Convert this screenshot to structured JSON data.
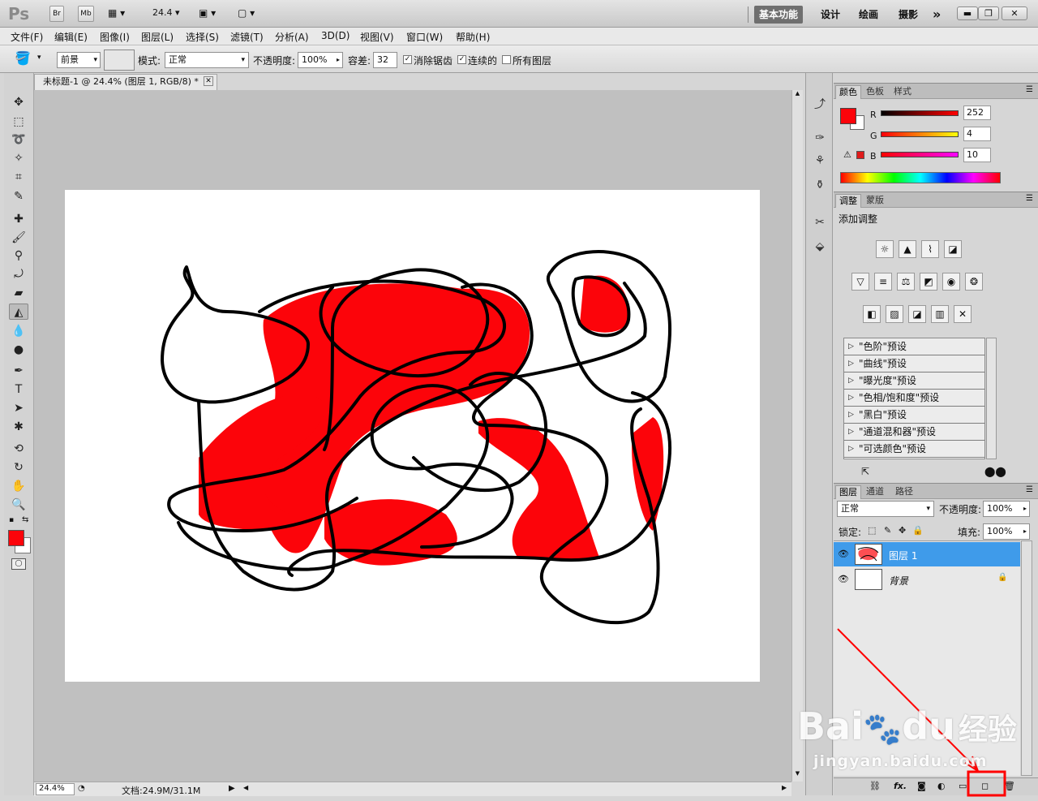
{
  "app": {
    "logo": "Ps",
    "bridge_label": "Br",
    "minibridge_label": "Mb",
    "zoom_value": "24.4",
    "workspaces": [
      "基本功能",
      "设计",
      "绘画",
      "摄影"
    ],
    "more_label": "»"
  },
  "menu": [
    "文件(F)",
    "编辑(E)",
    "图像(I)",
    "图层(L)",
    "选择(S)",
    "滤镜(T)",
    "分析(A)",
    "3D(D)",
    "视图(V)",
    "窗口(W)",
    "帮助(H)"
  ],
  "options": {
    "fill_source": "前景",
    "mode_label": "模式:",
    "mode_value": "正常",
    "opacity_label": "不透明度:",
    "opacity_value": "100%",
    "tolerance_label": "容差:",
    "tolerance_value": "32",
    "antialias_label": "消除锯齿",
    "contiguous_label": "连续的",
    "all_layers_label": "所有图层"
  },
  "document": {
    "tab_title": "未标题-1 @ 24.4% (图层 1, RGB/8) *",
    "zoom_status": "24.4%",
    "doc_status": "文档:24.9M/31.1M"
  },
  "color_panel": {
    "tabs": [
      "颜色",
      "色板",
      "样式"
    ],
    "channels": [
      {
        "label": "R",
        "value": "252"
      },
      {
        "label": "G",
        "value": "4"
      },
      {
        "label": "B",
        "value": "10"
      }
    ],
    "foreground_color": "#fc040a",
    "background_color": "#ffffff"
  },
  "adjust_panel": {
    "tabs": [
      "调整",
      "蒙版"
    ],
    "heading": "添加调整",
    "presets": [
      "\"色阶\"预设",
      "\"曲线\"预设",
      "\"曝光度\"预设",
      "\"色相/饱和度\"预设",
      "\"黑白\"预设",
      "\"通道混和器\"预设",
      "\"可选颜色\"预设"
    ]
  },
  "layers_panel": {
    "tabs": [
      "图层",
      "通道",
      "路径"
    ],
    "blend_mode": "正常",
    "opacity_label": "不透明度:",
    "opacity_value": "100%",
    "lock_label": "锁定:",
    "fill_label": "填充:",
    "fill_value": "100%",
    "layers": [
      {
        "name": "图层 1",
        "selected": true
      },
      {
        "name": "背景",
        "selected": false
      }
    ],
    "footer_fx": "fx."
  },
  "watermark": {
    "brand_text": "Bai",
    "brand_text2": "du",
    "brand_cn": "经验",
    "url": "jingyan.baidu.com"
  },
  "annotation_color": "#ff0000"
}
